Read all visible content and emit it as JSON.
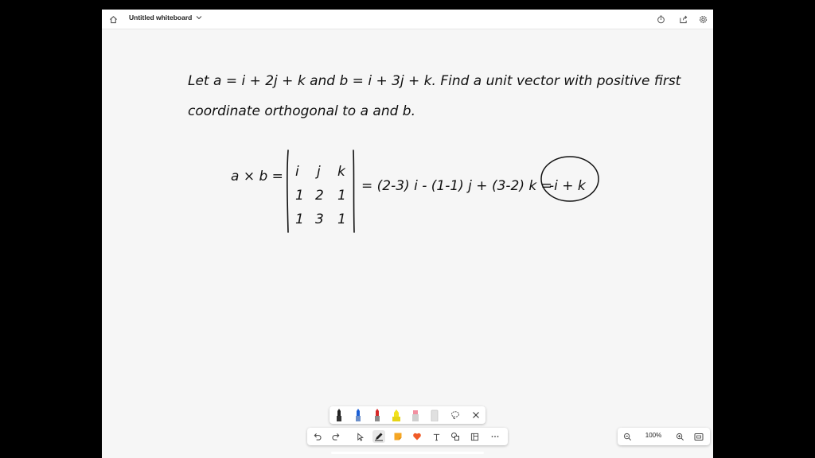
{
  "window": {
    "title": "Untitled whiteboard"
  },
  "handwriting": {
    "problem_line1": "Let a = i + 2j + k and b = i + 3j + k. Find a unit vector with positive first",
    "problem_line2": "coordinate orthogonal to a and b.",
    "cross_lhs": "a × b =",
    "det_row1": [
      "i",
      "j",
      "k"
    ],
    "det_row2": [
      "1",
      "2",
      "1"
    ],
    "det_row3": [
      "1",
      "3",
      "1"
    ],
    "expansion": "= (2-3) i - (1-1) j + (3-2) k =",
    "result": "-i + k"
  },
  "pen_tray": {
    "tools": [
      "black-pen",
      "blue-pen",
      "red-pen",
      "yellow-highlighter",
      "pink-highlighter",
      "eraser",
      "lasso",
      "close"
    ],
    "colors": {
      "black": "#222222",
      "blue": "#1a5fd6",
      "red": "#d62828",
      "yellow": "#f2e21c",
      "pink": "#f28fa0"
    }
  },
  "toolbar": {
    "tools": [
      "undo",
      "redo",
      "select",
      "pen",
      "note",
      "reaction",
      "text",
      "shapes",
      "template",
      "more"
    ]
  },
  "zoom": {
    "level": "100%"
  },
  "accent": "#f05a28"
}
